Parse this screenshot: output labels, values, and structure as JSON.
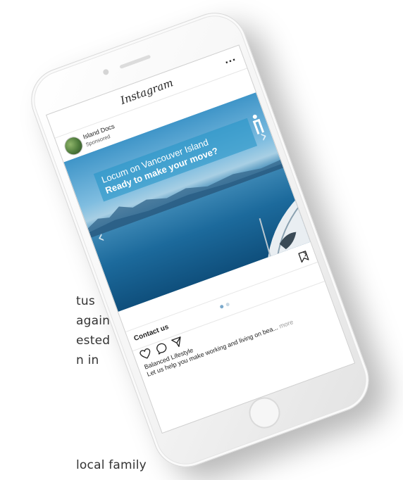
{
  "background_text": {
    "line1": "tus",
    "line2": "again",
    "line3": "ested",
    "line4": "n in",
    "line5": "local family"
  },
  "app": {
    "title": "Instagram",
    "more_label": "..."
  },
  "post": {
    "account_name": "Island Docs",
    "sponsored_label": "Sponsored",
    "ad": {
      "headline": "Locum on Vancouver Island",
      "subheadline": "Ready to make your move?",
      "prev_arrow": "‹",
      "next_arrow": "›"
    },
    "cta": {
      "chevron": "›",
      "label": "Contact us"
    },
    "carousel": {
      "slide_count": 2,
      "active_index": 0
    },
    "caption": {
      "title": "Balanced Lifestyle",
      "text": "Let us help you make working and living on bea...",
      "more_label": "more"
    }
  },
  "colors": {
    "banner": "#2896c8",
    "dot_active": "#7aa9cc",
    "dot_inactive": "#c7d8e4"
  },
  "icons": [
    "heart-icon",
    "comment-icon",
    "share-icon",
    "bookmark-icon",
    "more-icon",
    "chevron-right-icon"
  ]
}
